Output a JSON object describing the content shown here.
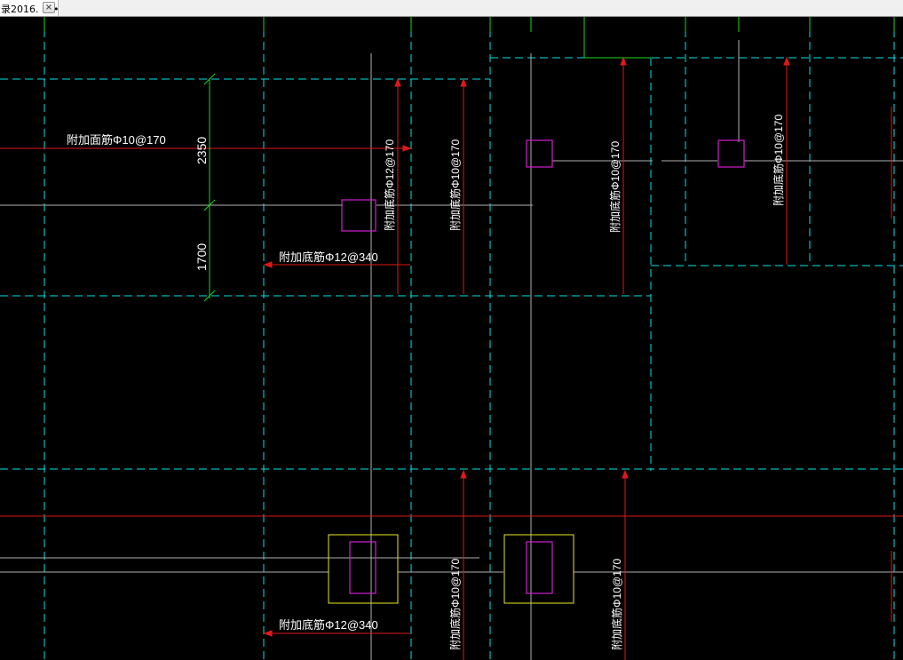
{
  "tab": {
    "title": "录2016. •••",
    "close_glyph": "×"
  },
  "colors": {
    "background": "#000000",
    "axis": "#00e5e5",
    "rebar": "#e01818",
    "dimension": "#18d818",
    "column": "#d020d0",
    "column_cap": "#e8e820",
    "text": "#ffffff",
    "centerline": "#b0b0b0"
  },
  "labels": {
    "top_rebar": "附加面筋Φ10@170",
    "bottom_rebar_340_upper": "附加底筋Φ12@340",
    "bottom_rebar_340_lower": "附加底筋Φ12@340",
    "vertical_12_170": "附加底筋Φ12@170",
    "vertical_10_170_a": "附加底筋Φ10@170",
    "vertical_10_170_b": "附加底筋Φ10@170",
    "vertical_10_170_c": "附加底筋Φ10@170",
    "vertical_10_170_d": "附加底筋Φ10@170",
    "vertical_10_170_e": "附加底筋Φ10@170"
  },
  "dimensions": {
    "upper": "2350",
    "lower": "1700"
  }
}
